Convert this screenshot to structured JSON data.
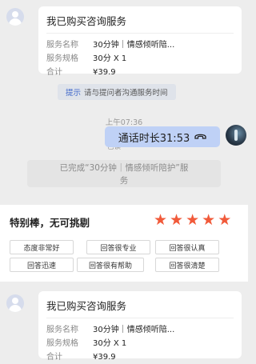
{
  "order_card_1": {
    "title": "我已购买咨询服务",
    "rows": [
      {
        "label": "服务名称",
        "value": "30分钟｜情感倾听陪..."
      },
      {
        "label": "服务规格",
        "value": "30分 X 1"
      },
      {
        "label": "合计",
        "value": "¥39.9"
      }
    ]
  },
  "tip": {
    "tag": "提示",
    "text": "请与提问者沟通服务时间"
  },
  "timestamp": "上午07:36",
  "call": {
    "text": "通话时长31:53",
    "read_status": "已读"
  },
  "system_message": {
    "line1": "已完成“30分钟｜情感倾听陪护”服",
    "line2": "务"
  },
  "review": {
    "title": "特别棒，无可挑剔",
    "stars": 5,
    "star_color": "#f15a3a",
    "tags": [
      "态度非常好",
      "回答很专业",
      "回答很认真",
      "回答迅速",
      "回答很有帮助",
      "回答很清楚"
    ]
  },
  "order_card_2": {
    "title": "我已购买咨询服务",
    "rows": [
      {
        "label": "服务名称",
        "value": "30分钟｜情感倾听陪..."
      },
      {
        "label": "服务规格",
        "value": "30分 X 1"
      },
      {
        "label": "合计",
        "value": "¥39.9"
      }
    ]
  }
}
